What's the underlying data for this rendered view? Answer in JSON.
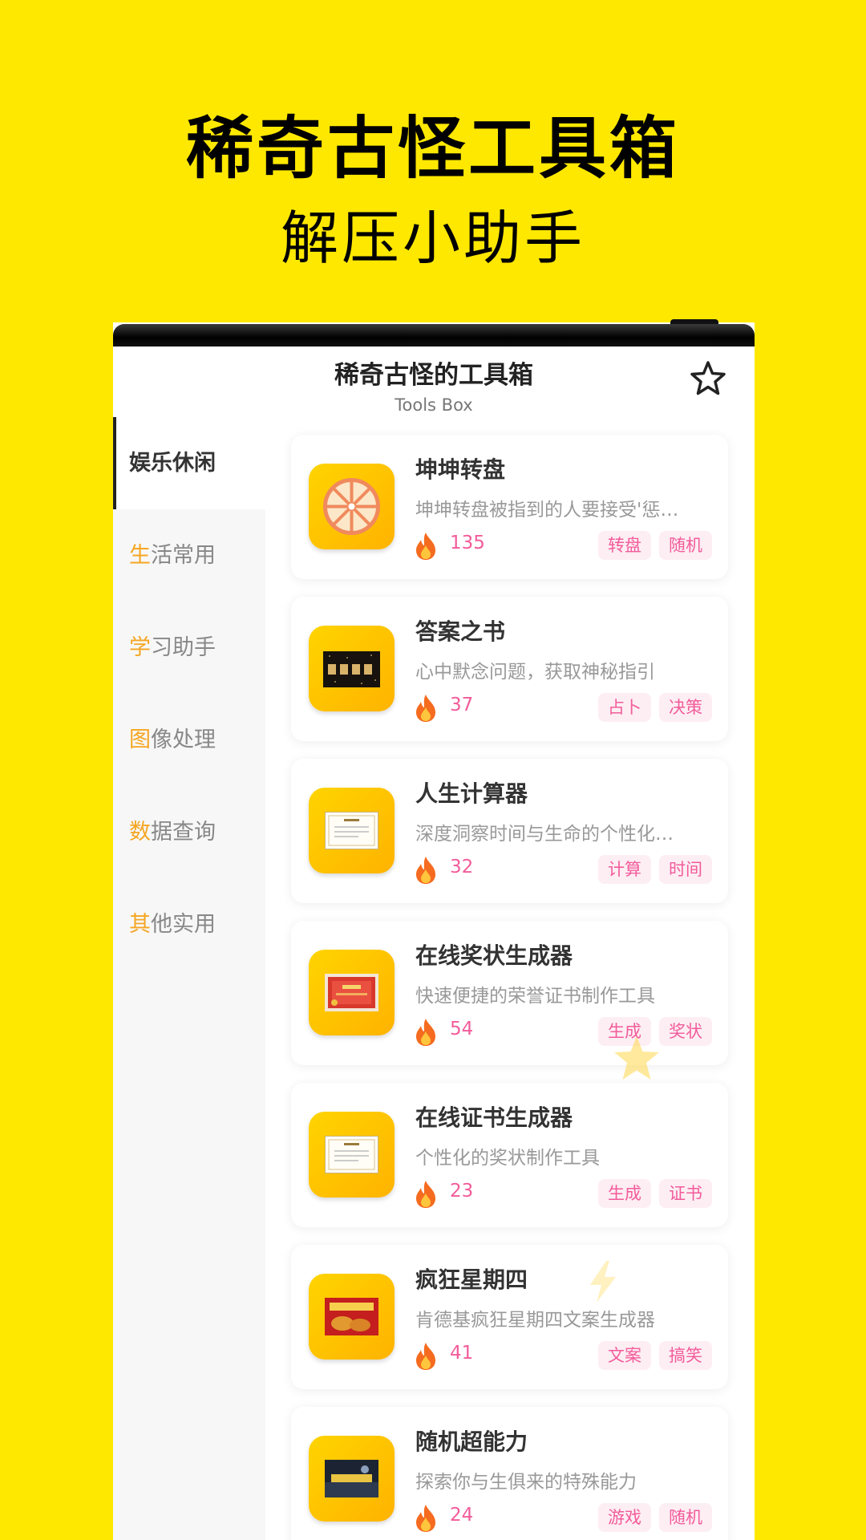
{
  "promo": {
    "title": "稀奇古怪工具箱",
    "subtitle": "解压小助手"
  },
  "app": {
    "title": "稀奇古怪的工具箱",
    "subtitle": "Tools Box",
    "favorite_icon": "star-outline-icon"
  },
  "sidebar": {
    "items": [
      {
        "first": "娱",
        "rest": "乐休闲",
        "active": true
      },
      {
        "first": "生",
        "rest": "活常用",
        "active": false
      },
      {
        "first": "学",
        "rest": "习助手",
        "active": false
      },
      {
        "first": "图",
        "rest": "像处理",
        "active": false
      },
      {
        "first": "数",
        "rest": "据查询",
        "active": false
      },
      {
        "first": "其",
        "rest": "他实用",
        "active": false
      }
    ]
  },
  "tools": [
    {
      "title": "坤坤转盘",
      "desc": "坤坤转盘被指到的人要接受'惩…",
      "count": "135",
      "tags": [
        "转盘",
        "随机"
      ],
      "icon": "wheel-icon"
    },
    {
      "title": "答案之书",
      "desc": "心中默念问题，获取神秘指引",
      "count": "37",
      "tags": [
        "占卜",
        "决策"
      ],
      "icon": "answer-book-icon"
    },
    {
      "title": "人生计算器",
      "desc": "深度洞察时间与生命的个性化…",
      "count": "32",
      "tags": [
        "计算",
        "时间"
      ],
      "icon": "certificate-icon"
    },
    {
      "title": "在线奖状生成器",
      "desc": "快速便捷的荣誉证书制作工具",
      "count": "54",
      "tags": [
        "生成",
        "奖状"
      ],
      "icon": "award-icon"
    },
    {
      "title": "在线证书生成器",
      "desc": "个性化的奖状制作工具",
      "count": "23",
      "tags": [
        "生成",
        "证书"
      ],
      "icon": "certificate-icon"
    },
    {
      "title": "疯狂星期四",
      "desc": "肯德基疯狂星期四文案生成器",
      "count": "41",
      "tags": [
        "文案",
        "搞笑"
      ],
      "icon": "crazy-thursday-icon"
    },
    {
      "title": "随机超能力",
      "desc": "探索你与生俱来的特殊能力",
      "count": "24",
      "tags": [
        "游戏",
        "随机"
      ],
      "icon": "superpower-icon"
    }
  ],
  "colors": {
    "background": "#FFE800",
    "accent_pink": "#F25C9B",
    "thumb_yellow": "#FFC400"
  }
}
